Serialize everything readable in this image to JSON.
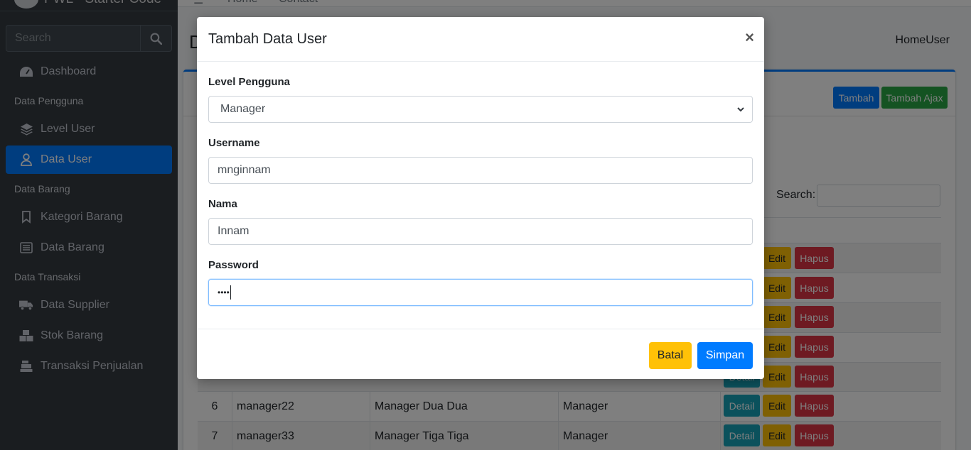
{
  "brand": {
    "name": "PWL - Starter Code"
  },
  "sidebar": {
    "search_placeholder": "Search",
    "items": [
      {
        "label": "Dashboard",
        "icon": "dashboard-icon"
      },
      {
        "header": "Data Pengguna"
      },
      {
        "label": "Level User",
        "icon": "layers-icon"
      },
      {
        "label": "Data User",
        "icon": "user-icon",
        "active": true
      },
      {
        "header": "Data Barang"
      },
      {
        "label": "Kategori Barang",
        "icon": "bookmark-icon"
      },
      {
        "label": "Data Barang",
        "icon": "list-icon"
      },
      {
        "header": "Data Transaksi"
      },
      {
        "label": "Data Supplier",
        "icon": "truck-icon"
      },
      {
        "label": "Stok Barang",
        "icon": "boxes-icon"
      },
      {
        "label": "Transaksi Penjualan",
        "icon": "cash-register-icon"
      }
    ]
  },
  "topnav": {
    "home": "Home",
    "contact": "Contact"
  },
  "page": {
    "title": "D",
    "breadcrumb": "HomeUser",
    "add_button": "Tambah",
    "add_ajax_button": "Tambah Ajax",
    "search_label": "Search:"
  },
  "table": {
    "rows": [
      {
        "no": "6",
        "username": "manager22",
        "nama": "Manager Dua Dua",
        "level": "Manager"
      },
      {
        "no": "7",
        "username": "manager33",
        "nama": "Manager Tiga Tiga",
        "level": "Manager"
      }
    ],
    "actions": {
      "detail": "Detail",
      "edit": "Edit",
      "delete": "Hapus"
    }
  },
  "modal": {
    "title": "Tambah Data User",
    "close": "×",
    "level_label": "Level Pengguna",
    "level_value": "Manager",
    "username_label": "Username",
    "username_value": "mnginnam",
    "nama_label": "Nama",
    "nama_value": "Innam",
    "password_label": "Password",
    "password_value": "••••",
    "cancel_button": "Batal",
    "save_button": "Simpan"
  },
  "colors": {
    "primary": "#007bff",
    "warning": "#ffc107",
    "danger": "#dc3545",
    "info": "#17a2b8",
    "success": "#28a745",
    "sidebar": "#343a40"
  }
}
